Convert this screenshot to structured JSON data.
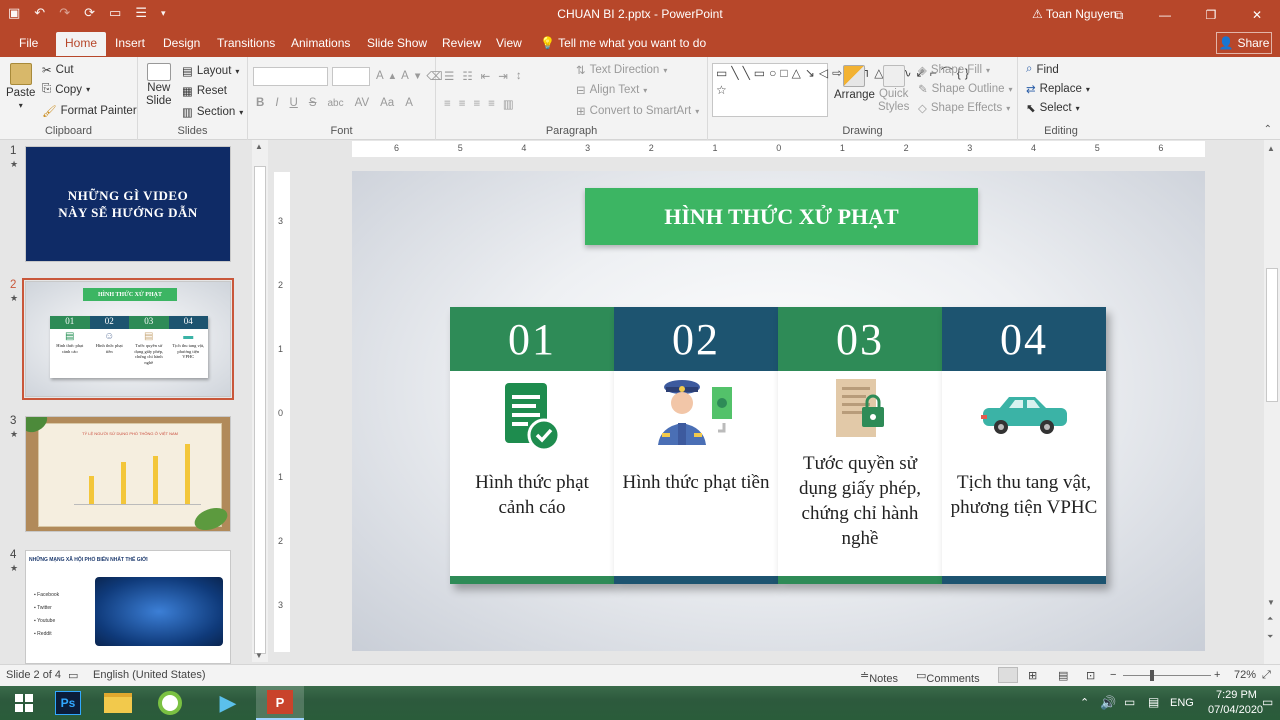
{
  "titlebar": {
    "doc_title": "CHUAN BI 2.pptx - PowerPoint",
    "user": "Toan Nguyen"
  },
  "tabs": [
    "File",
    "Home",
    "Insert",
    "Design",
    "Transitions",
    "Animations",
    "Slide Show",
    "Review",
    "View"
  ],
  "tell_me": "Tell me what you want to do",
  "share": "Share",
  "ribbon": {
    "clipboard": {
      "paste": "Paste",
      "cut": "Cut",
      "copy": "Copy",
      "format_painter": "Format Painter",
      "label": "Clipboard"
    },
    "slides": {
      "new_slide_1": "New",
      "new_slide_2": "Slide",
      "layout": "Layout",
      "reset": "Reset",
      "section": "Section",
      "label": "Slides"
    },
    "font": {
      "label": "Font",
      "bold": "B",
      "italic": "I",
      "underline": "U",
      "strike": "S",
      "shadow": "abc"
    },
    "paragraph": {
      "text_direction": "Text Direction",
      "align_text": "Align Text",
      "convert": "Convert to SmartArt",
      "label": "Paragraph"
    },
    "drawing": {
      "arrange": "Arrange",
      "quick_1": "Quick",
      "quick_2": "Styles",
      "shape_fill": "Shape Fill",
      "shape_outline": "Shape Outline",
      "shape_effects": "Shape Effects",
      "label": "Drawing"
    },
    "editing": {
      "find": "Find",
      "replace": "Replace",
      "select": "Select",
      "label": "Editing"
    }
  },
  "thumbnails": [
    {
      "num": "1",
      "title": "NHỮNG GÌ VIDEO NÀY SẼ HƯỚNG DẪN"
    },
    {
      "num": "2",
      "title": "HÌNH THỨC XỬ PHẠT",
      "cells": [
        "01",
        "02",
        "03",
        "04"
      ],
      "captions": [
        "Hình thức phạt cảnh cáo",
        "Hình thức phạt tiền",
        "Tước quyền sử dụng giấy phép, chứng chỉ hành nghề",
        "Tịch thu tang vật, phương tiện VPHC"
      ]
    },
    {
      "num": "3",
      "title": "TỶ LỆ NGƯỜI SỬ DỤNG PHỔ THÔNG Ở VIỆT NAM"
    },
    {
      "num": "4",
      "title": "NHỮNG MẠNG XÃ HỘI PHỔ BIẾN NHẤT THẾ GIỚI",
      "links": [
        "Facebook",
        "Twitter",
        "Youtube",
        "Reddit"
      ]
    }
  ],
  "ruler_h": [
    "6",
    "5",
    "4",
    "3",
    "2",
    "1",
    "0",
    "1",
    "2",
    "3",
    "4",
    "5",
    "6"
  ],
  "ruler_v": [
    "3",
    "2",
    "1",
    "0",
    "1",
    "2",
    "3"
  ],
  "slide": {
    "title": "HÌNH THỨC XỬ PHẠT",
    "cards": [
      {
        "num": "01",
        "text": "Hình thức phạt cảnh cáo",
        "header_color": "#2e8b57",
        "icon": "document-check-icon"
      },
      {
        "num": "02",
        "text": "Hình thức phạt tiền",
        "header_color": "#1d5470",
        "icon": "police-money-icon"
      },
      {
        "num": "03",
        "text": "Tước quyền sử dụng giấy phép, chứng chỉ hành nghề",
        "header_color": "#2e8b57",
        "icon": "license-lock-icon"
      },
      {
        "num": "04",
        "text": "Tịch thu tang vật, phương tiện VPHC",
        "header_color": "#1d5470",
        "icon": "car-icon"
      }
    ]
  },
  "status": {
    "slide_info": "Slide 2 of 4",
    "language": "English (United States)",
    "notes": "Notes",
    "comments": "Comments",
    "zoom": "72%"
  },
  "taskbar": {
    "lang": "ENG",
    "time": "7:29 PM",
    "date": "07/04/2020"
  }
}
